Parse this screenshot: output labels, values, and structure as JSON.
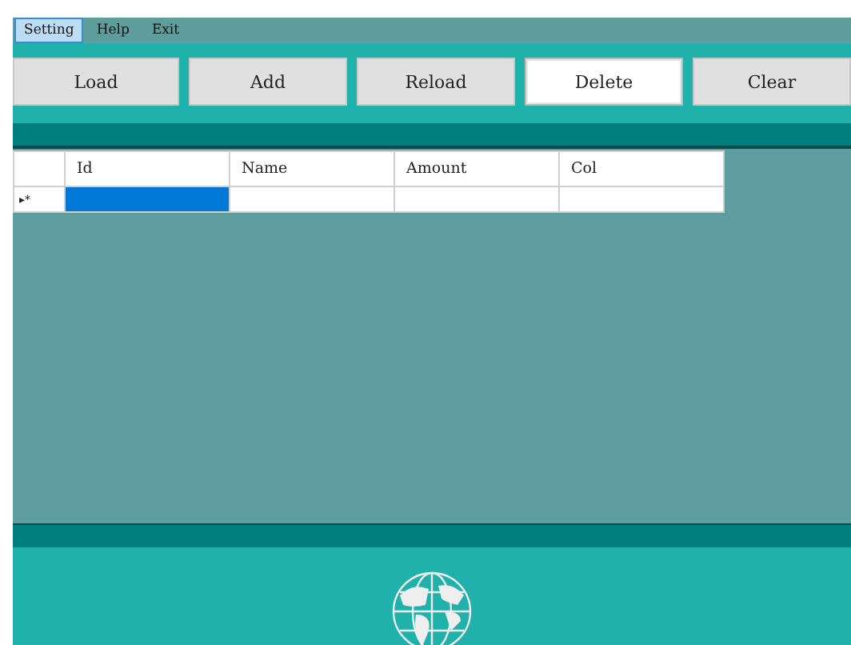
{
  "menu": [
    {
      "label": "Setting",
      "selected": true
    },
    {
      "label": "Help",
      "selected": false
    },
    {
      "label": "Exit",
      "selected": false
    }
  ],
  "toolbar": [
    {
      "label": "Load",
      "focused": false
    },
    {
      "label": "Add",
      "focused": false
    },
    {
      "label": "Reload",
      "focused": false
    },
    {
      "label": "Delete",
      "focused": true
    },
    {
      "label": "Clear",
      "focused": false
    }
  ],
  "grid": {
    "columns": [
      "Id",
      "Name",
      "Amount",
      "Col"
    ],
    "rows": [
      {
        "marker": "▸*",
        "cells": [
          {
            "text": "",
            "selected": true
          },
          {
            "text": "",
            "selected": false
          },
          {
            "text": "",
            "selected": false
          },
          {
            "text": "",
            "selected": false
          }
        ]
      }
    ]
  }
}
